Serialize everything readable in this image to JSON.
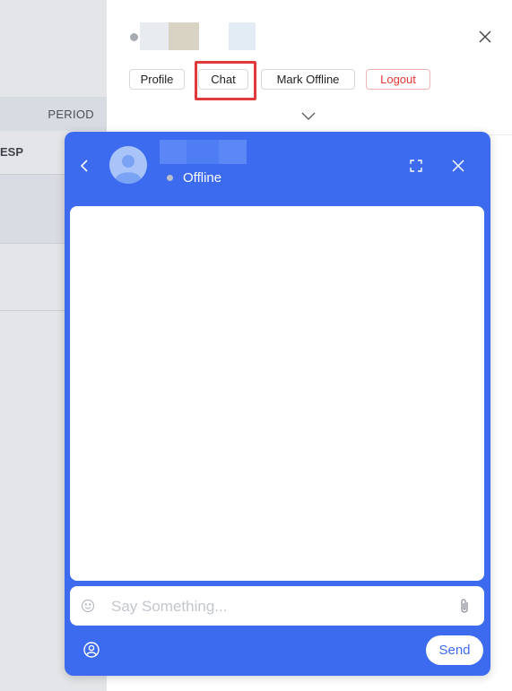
{
  "background": {
    "table_header": "PERIOD",
    "row_label": "ESP"
  },
  "panel": {
    "actions": {
      "profile": "Profile",
      "chat": "Chat",
      "mark_offline": "Mark Offline",
      "logout": "Logout"
    },
    "icons": {
      "close": "close-icon",
      "expand": "chevron-down-icon"
    }
  },
  "chat": {
    "status": "Offline",
    "input_placeholder": "Say Something...",
    "send_label": "Send",
    "icons": {
      "back": "chevron-left-icon",
      "avatar": "user-avatar",
      "fullscreen": "fullscreen-icon",
      "close": "close-icon",
      "emoji": "emoji-icon",
      "attach": "paperclip-icon",
      "user": "user-circle-icon"
    }
  },
  "colors": {
    "chat_accent": "#3d6bf0",
    "logout": "#e53935",
    "highlight": "#e03a3a"
  }
}
